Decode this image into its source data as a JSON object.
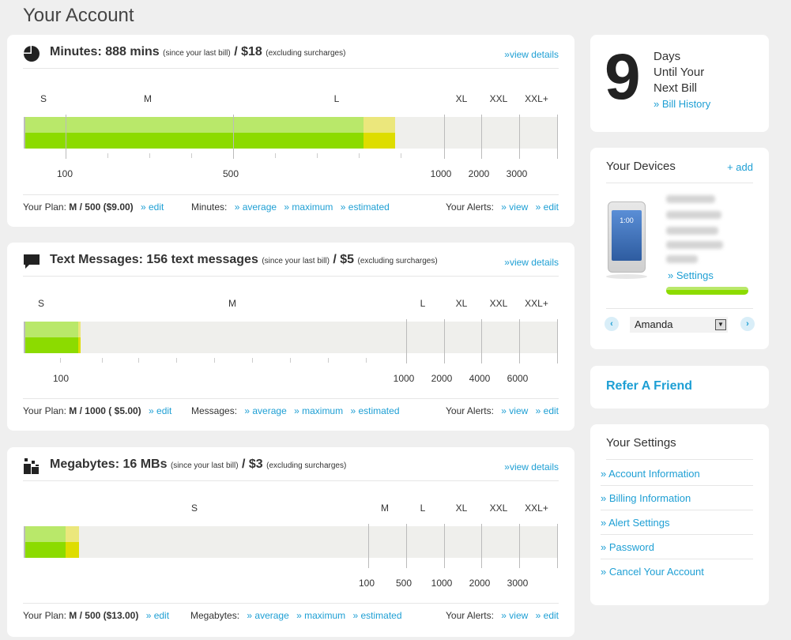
{
  "page": {
    "title": "Your Account"
  },
  "colors": {
    "accent": "#1e9fd4",
    "green_top": "#b9e86a",
    "green_bottom": "#8cdb00",
    "yellow_top": "#ebe77c",
    "yellow_bottom": "#dedd00"
  },
  "minutes": {
    "title": "Minutes: 888 mins",
    "since": "(since your last bill)",
    "slash": "/",
    "price": "$18",
    "excluding": "(excluding surcharges)",
    "view_details": "»view details",
    "tiers": [
      "S",
      "M",
      "L",
      "XL",
      "XXL",
      "XXL+"
    ],
    "scale": [
      "100",
      "500",
      "1000",
      "2000",
      "3000"
    ],
    "usage": {
      "green_fraction": 0.635,
      "yellow_fraction": 0.06
    },
    "plan_label": "Your Plan:",
    "plan_value": "M / 500 ($9.00)",
    "edit": "» edit",
    "usage_label": "Minutes:",
    "average": "» average",
    "maximum": "» maximum",
    "estimated": "» estimated",
    "alerts_label": "Your Alerts:",
    "view": "» view",
    "alerts_edit": "» edit"
  },
  "texts": {
    "title": "Text Messages: 156 text messages",
    "since": "(since your last bill)",
    "slash": "/",
    "price": "$5",
    "excluding": "(excluding surcharges)",
    "view_details": "»view details",
    "tiers": [
      "S",
      "M",
      "L",
      "XL",
      "XXL",
      "XXL+"
    ],
    "scale": [
      "100",
      "1000",
      "2000",
      "4000",
      "6000"
    ],
    "usage": {
      "green_fraction": 0.1,
      "yellow_fraction": 0.005
    },
    "plan_label": "Your Plan:",
    "plan_value": "M / 1000 ( $5.00)",
    "edit": "» edit",
    "usage_label": "Messages:",
    "average": "» average",
    "maximum": "» maximum",
    "estimated": "» estimated",
    "alerts_label": "Your Alerts:",
    "view": "» view",
    "alerts_edit": "» edit"
  },
  "data": {
    "title": "Megabytes: 16 MBs",
    "since": "(since your last bill)",
    "slash": "/",
    "price": "$3",
    "excluding": "(excluding surcharges)",
    "view_details": "»view details",
    "tiers": [
      "S",
      "M",
      "L",
      "XL",
      "XXL",
      "XXL+"
    ],
    "scale": [
      "100",
      "500",
      "1000",
      "2000",
      "3000"
    ],
    "usage": {
      "green_fraction": 0.075,
      "yellow_fraction": 0.025
    },
    "plan_label": "Your Plan:",
    "plan_value": "M / 500 ($13.00)",
    "edit": "» edit",
    "usage_label": "Megabytes:",
    "average": "» average",
    "maximum": "» maximum",
    "estimated": "» estimated",
    "alerts_label": "Your Alerts:",
    "view": "» view",
    "alerts_edit": "» edit"
  },
  "bill": {
    "days": "9",
    "line1": "Days",
    "line2": "Until Your",
    "line3": "Next Bill",
    "history": "» Bill History"
  },
  "devices": {
    "title": "Your Devices",
    "add": "+ add",
    "phone_time": "1:00",
    "settings": "» Settings",
    "usage_fraction": 1.0,
    "prev": "‹",
    "next": "›",
    "selected": "Amanda",
    "dropdown": "▼"
  },
  "refer": {
    "label": "Refer A Friend"
  },
  "settings": {
    "title": "Your Settings",
    "items": [
      "» Account Information",
      "» Billing Information",
      "» Alert Settings",
      "» Password",
      "» Cancel Your Account"
    ]
  }
}
